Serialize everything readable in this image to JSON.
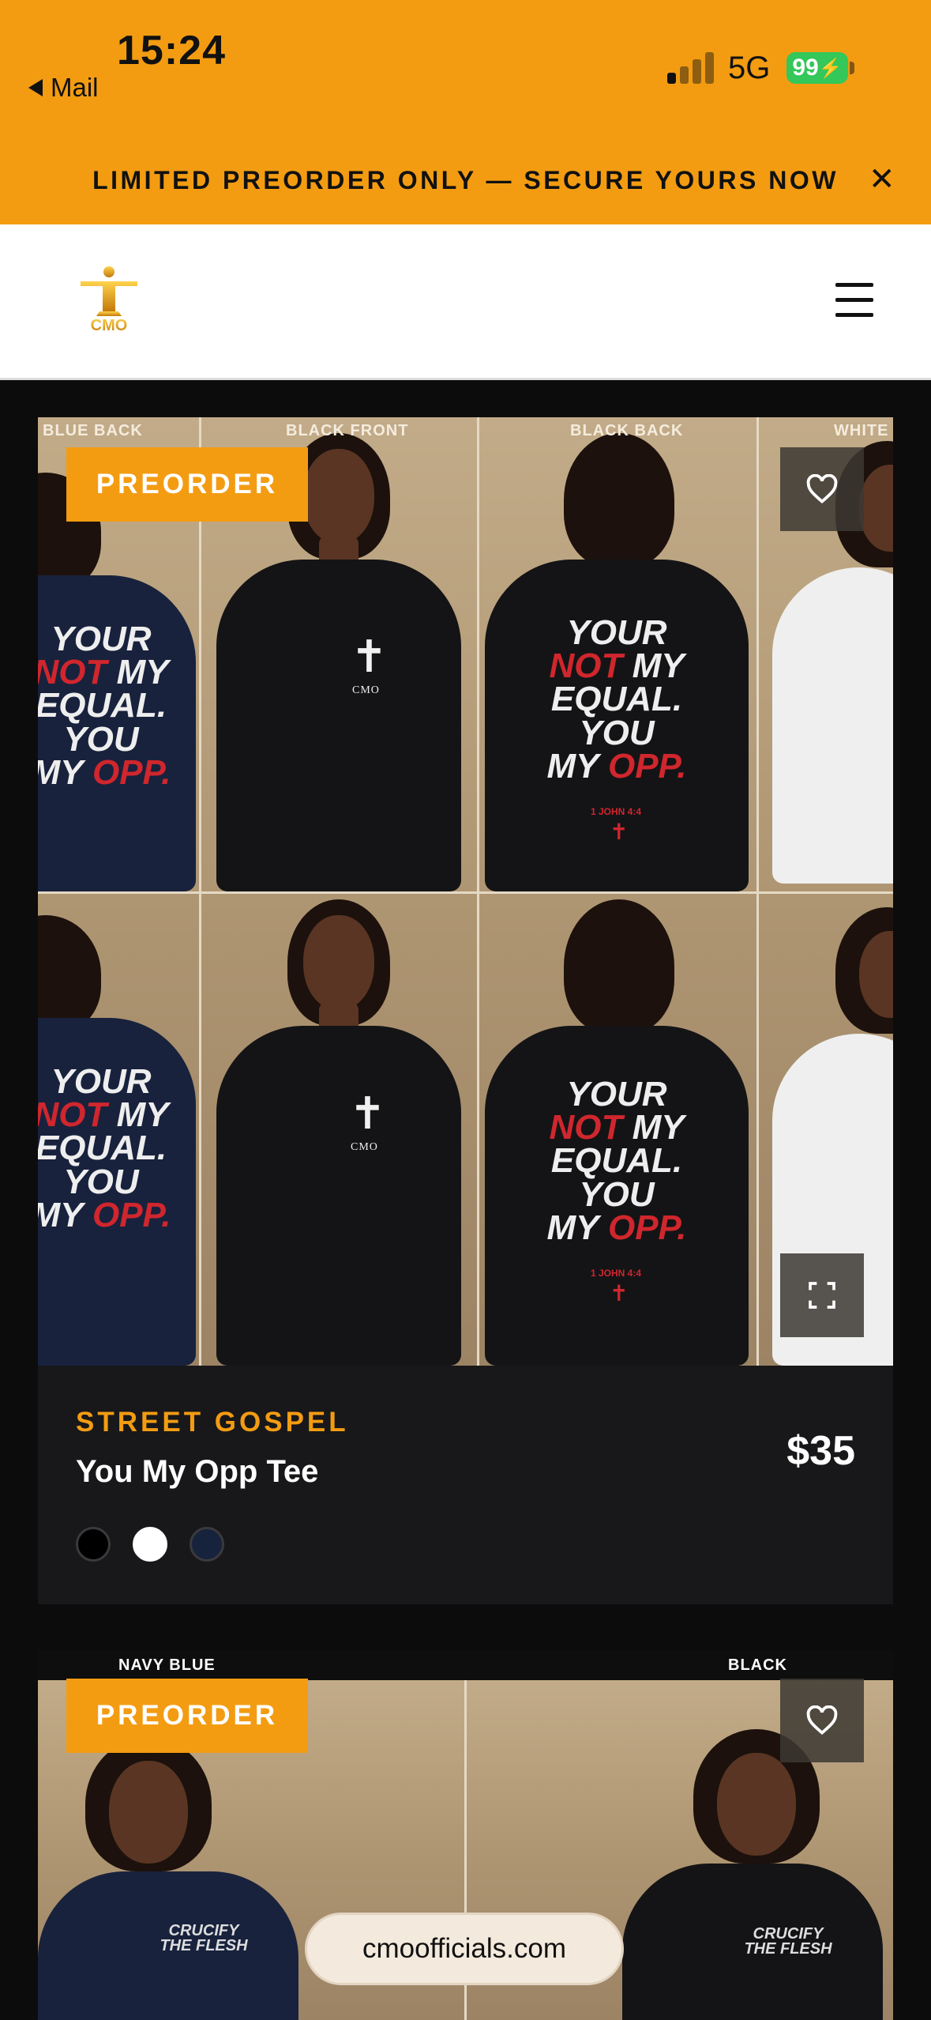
{
  "status_bar": {
    "time": "15:24",
    "back_app": "Mail",
    "network": "5G",
    "battery": "99"
  },
  "announcement": {
    "text": "LIMITED PREORDER ONLY — SECURE YOURS NOW",
    "close_icon": "close-icon"
  },
  "header": {
    "logo_text": "CMO",
    "menu_icon": "hamburger-menu-icon"
  },
  "products": [
    {
      "badge": "PREORDER",
      "collection": "STREET GOSPEL",
      "name": "You My Opp Tee",
      "price": "$35",
      "photo_labels": [
        "BLUE BACK",
        "BLACK FRONT",
        "BLACK BACK",
        "WHITE"
      ],
      "shirt_print": {
        "line1": "YOUR",
        "line2_red": "NOT",
        "line2": "MY",
        "line3": "EQUAL.",
        "line4": "YOU",
        "line5": "MY",
        "line5_red": "OPP.",
        "verse": "1 JOHN 4:4",
        "front_mark": "CMO"
      },
      "swatches": [
        "#000000",
        "#ffffff",
        "#17223d"
      ]
    },
    {
      "badge": "PREORDER",
      "photo_labels": [
        "NAVY BLUE",
        "BLACK"
      ],
      "shirt_print": {
        "line1": "CRUCIFY",
        "line2": "THE FLESH"
      }
    }
  ],
  "site_pill": "cmoofficials.com",
  "colors": {
    "accent": "#f39c12",
    "card_bg": "#18181a",
    "page_bg": "#0c0c0d"
  }
}
